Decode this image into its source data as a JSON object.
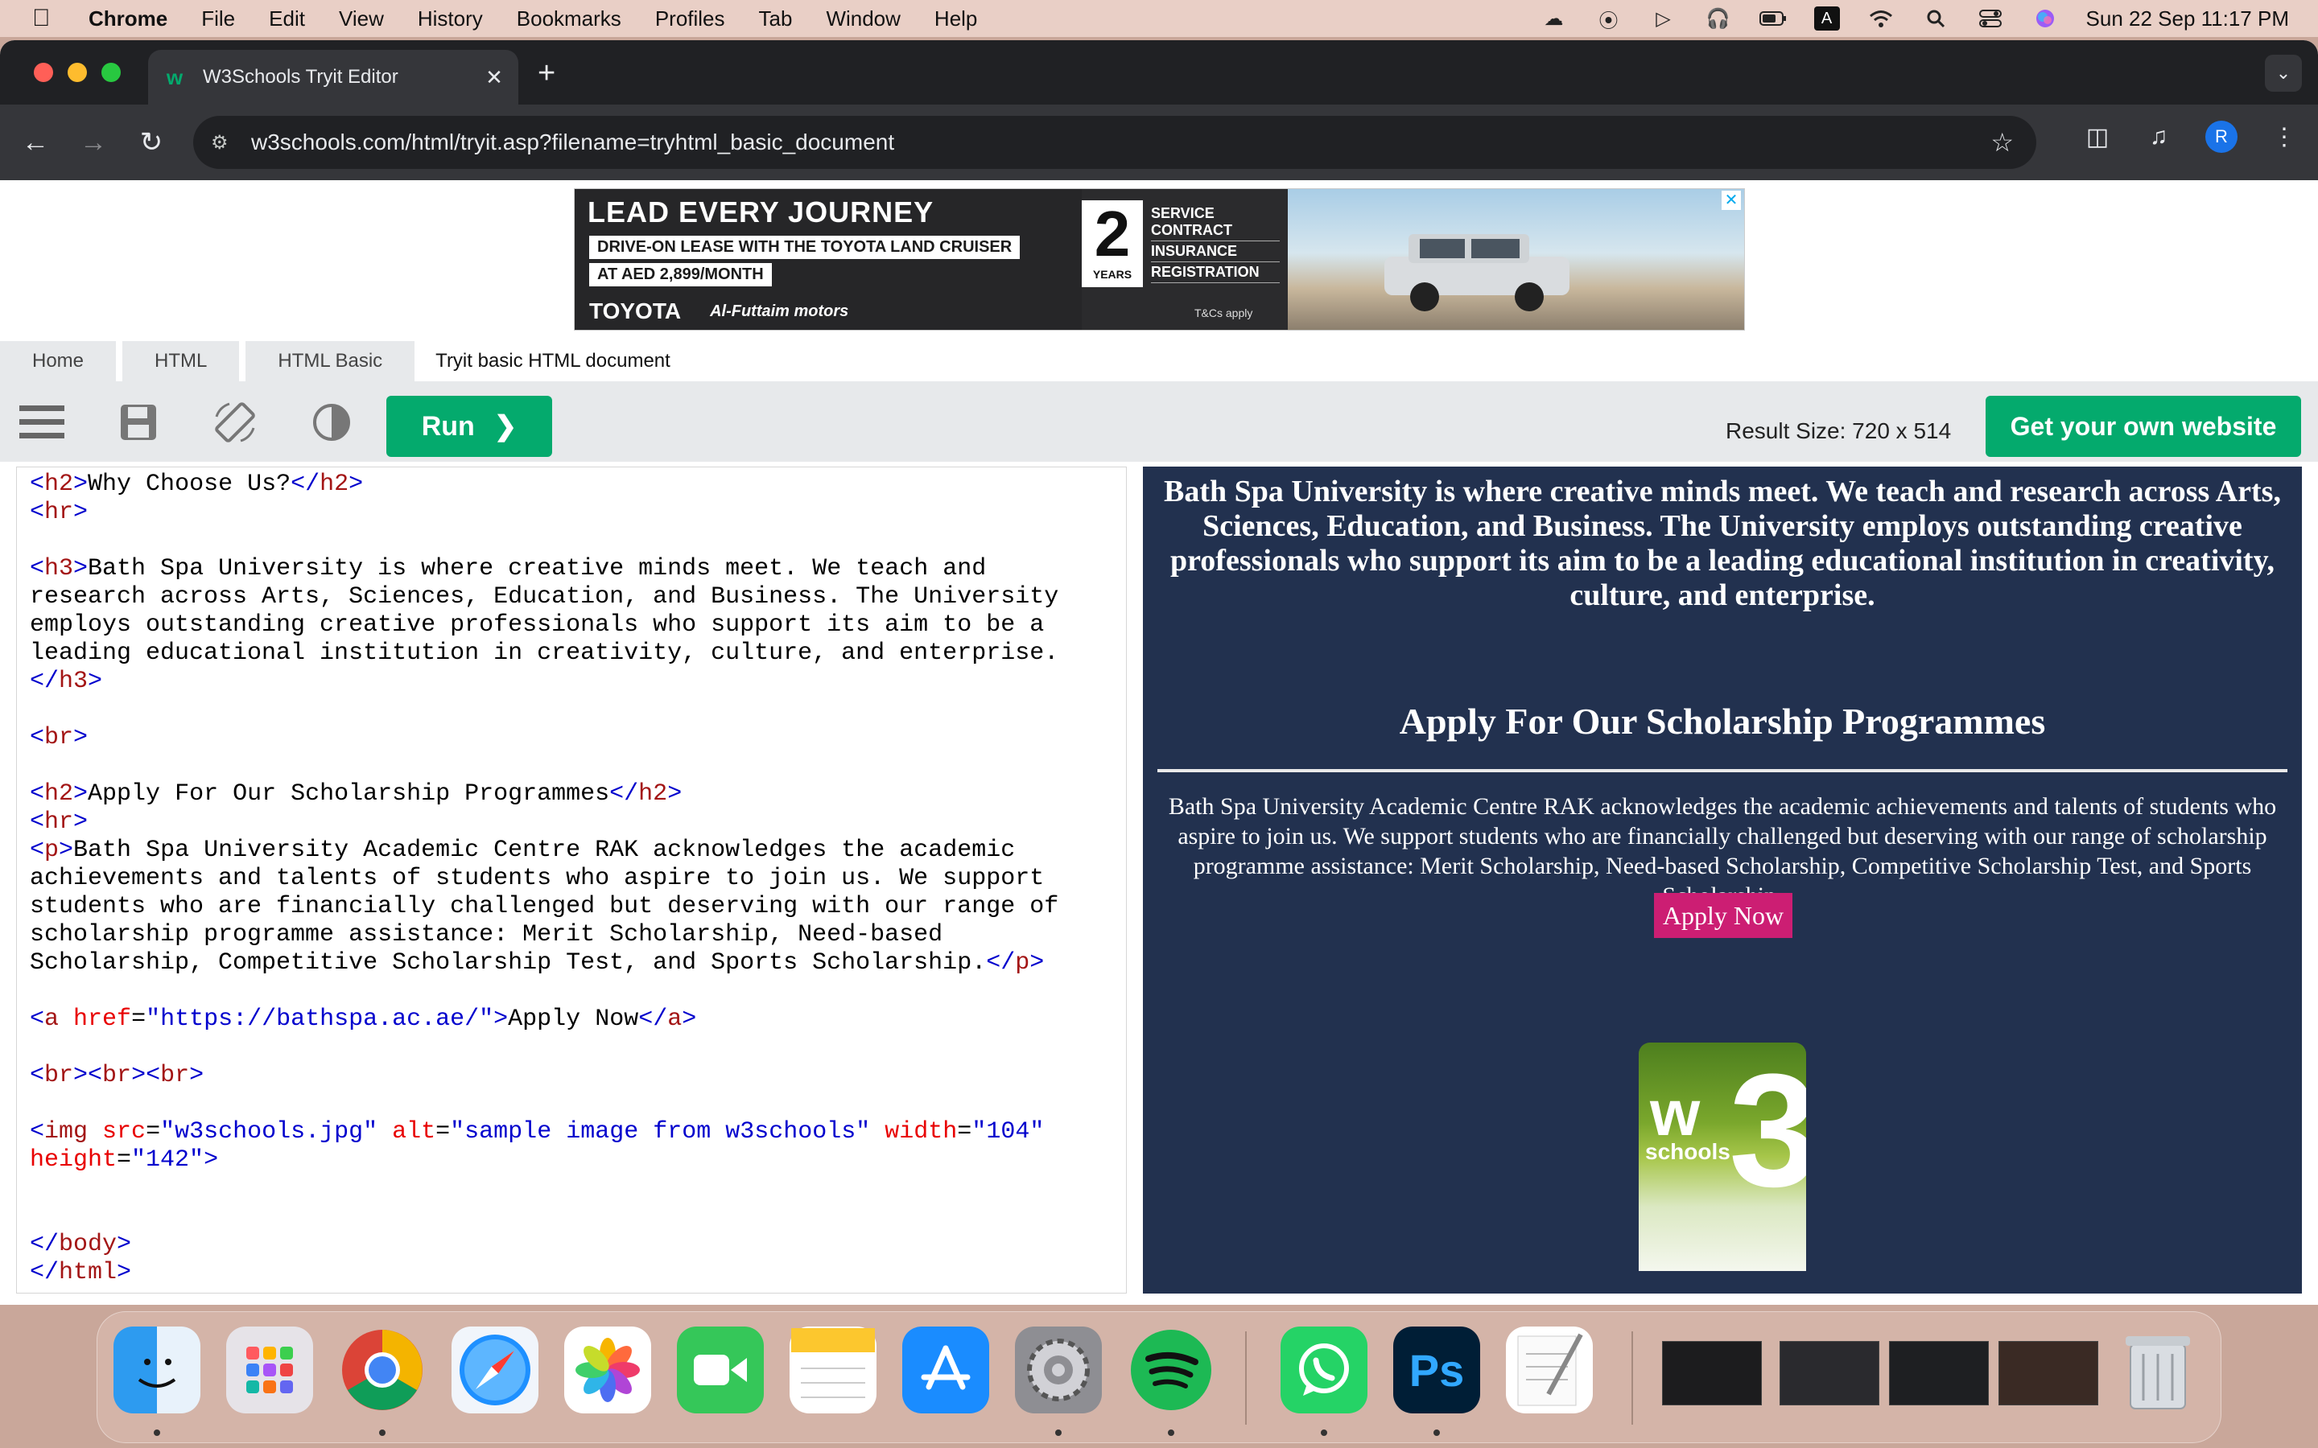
{
  "menubar": {
    "app": "Chrome",
    "items": [
      "File",
      "Edit",
      "View",
      "History",
      "Bookmarks",
      "Profiles",
      "Tab",
      "Window",
      "Help"
    ],
    "clock": "Sun 22 Sep  11:17 PM",
    "input_indicator": "A"
  },
  "browser": {
    "tab_title": "W3Schools Tryit Editor",
    "url": "w3schools.com/html/tryit.asp?filename=tryhtml_basic_document",
    "profile_initial": "R"
  },
  "ad": {
    "headline": "LEAD EVERY JOURNEY",
    "line1": "DRIVE-ON LEASE WITH THE TOYOTA LAND CRUISER",
    "line2": "AT AED 2,899/MONTH",
    "brand": "TOYOTA",
    "dealer": "Al-Futtaim motors",
    "years_num": "2",
    "years_label": "YEARS",
    "perks": [
      "SERVICE CONTRACT",
      "INSURANCE",
      "REGISTRATION"
    ],
    "terms": "T&Cs apply"
  },
  "breadcrumbs": [
    "Home",
    "HTML",
    "HTML Basic",
    "Tryit basic HTML document"
  ],
  "tryit": {
    "run_label": "Run",
    "result_size": "Result Size: 720 x 514",
    "own_site": "Get your own website"
  },
  "result": {
    "h3": "Bath Spa University is where creative minds meet. We teach and research across Arts, Sciences, Education, and Business. The University employs outstanding creative professionals who support its aim to be a leading educational institution in creativity, culture, and enterprise.",
    "h2": "Apply For Our Scholarship Programmes",
    "p": "Bath Spa University Academic Centre RAK acknowledges the academic achievements and talents of students who aspire to join us. We support students who are financially challenged but deserving with our range of scholarship programme assistance: Merit Scholarship, Need-based Scholarship, Competitive Scholarship Test, and Sports Scholarship.",
    "link": "Apply Now",
    "image_text": "schools"
  },
  "code": {
    "h2a_text": "Why Choose Us?",
    "h3_lines": [
      "Bath Spa University is where creative minds meet. We teach and",
      "research across Arts, Sciences, Education, and Business. The University",
      "employs outstanding creative professionals who support its aim to be a",
      "leading educational institution in creativity, culture, and enterprise."
    ],
    "h2b_text": "Apply For Our Scholarship Programmes",
    "p_lines": [
      "Bath Spa University Academic Centre RAK acknowledges the academic",
      "achievements and talents of students who aspire to join us. We support",
      "students who are financially challenged but deserving with our range of",
      "scholarship programme assistance: Merit Scholarship, Need-based",
      "Scholarship, Competitive Scholarship Test, and Sports Scholarship."
    ],
    "href": "\"https://bathspa.ac.ae/\"",
    "link_text": "Apply Now",
    "img_src": "\"w3schools.jpg\"",
    "img_alt": "\"sample image from w3schools\"",
    "img_width": "\"104\"",
    "img_height": "\"142\""
  },
  "dock": {
    "apps": [
      "finder-icon",
      "launchpad-icon",
      "chrome-icon",
      "safari-icon",
      "photos-icon",
      "facetime-icon",
      "notes-icon",
      "app-store-icon",
      "system-settings-icon",
      "spotify-icon",
      "whatsapp-icon",
      "photoshop-icon",
      "textedit-icon",
      "trash-icon"
    ],
    "photoshop_label": "Ps"
  }
}
